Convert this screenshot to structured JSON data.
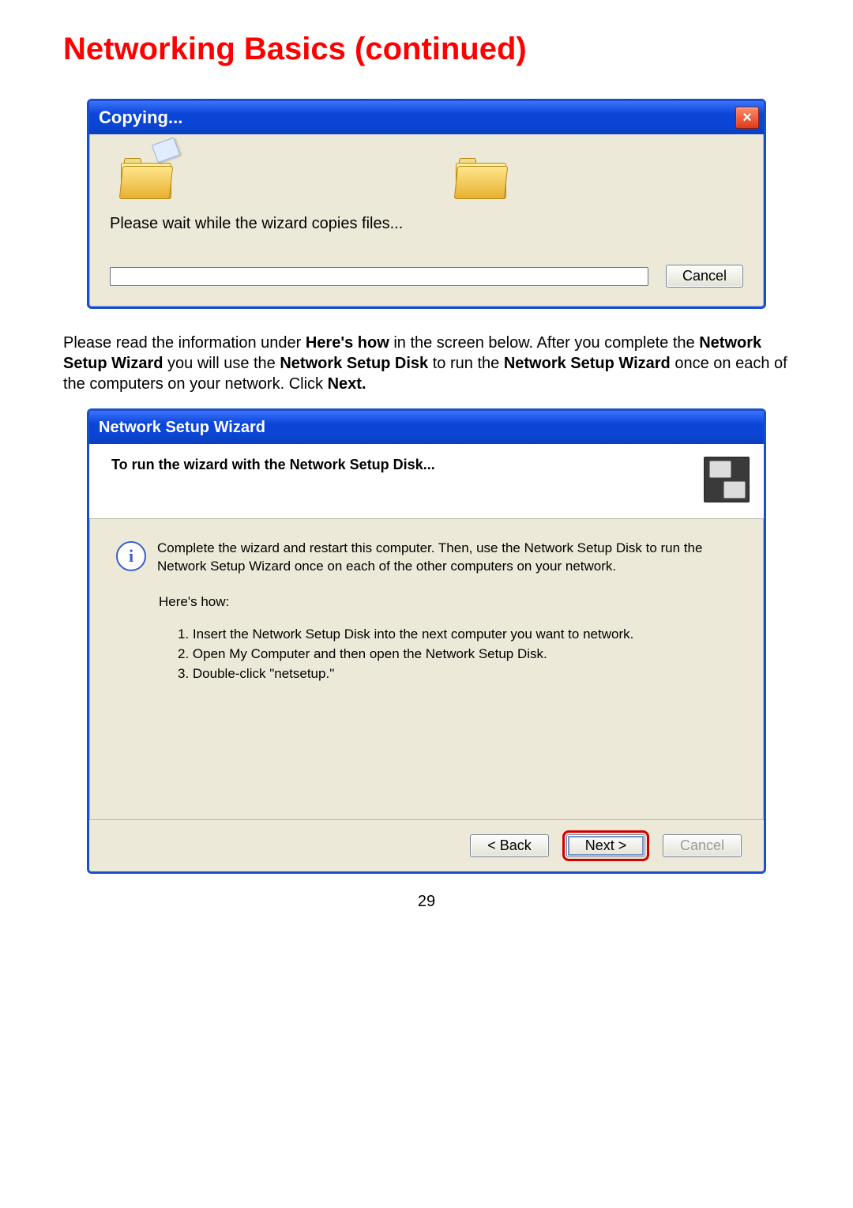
{
  "doc": {
    "heading": "Networking Basics (continued)",
    "para_1a": "Please read the information under ",
    "para_1b": "Here's how",
    "para_1c": " in the screen below.  After you complete the ",
    "para_1d": "Network Setup Wizard",
    "para_1e": " you will use the ",
    "para_1f": "Network Setup Disk",
    "para_1g": " to run the ",
    "para_1h": "Network Setup Wizard",
    "para_1i": " once on each of the computers on your network. Click ",
    "para_1j": "Next.",
    "page_number": "29"
  },
  "copy_dlg": {
    "title": "Copying...",
    "message": "Please wait while the wizard copies files...",
    "cancel": "Cancel",
    "close_x": "×"
  },
  "wizard_dlg": {
    "title": "Network Setup Wizard",
    "header": "To run the wizard with the Network Setup Disk...",
    "info_i": "i",
    "info_text": "Complete the wizard and restart this computer. Then, use the Network Setup Disk to run the Network Setup Wizard once on each of the other computers on your network.",
    "how_label": "Here's how:",
    "steps": {
      "0": "1.  Insert the Network Setup Disk into the next computer you want to network.",
      "1": "2.  Open My Computer and then open the Network Setup Disk.",
      "2": "3.  Double-click \"netsetup.\""
    },
    "back": "< Back",
    "next": "Next >",
    "cancel": "Cancel",
    "back_ul": "B",
    "next_ul": "N"
  }
}
